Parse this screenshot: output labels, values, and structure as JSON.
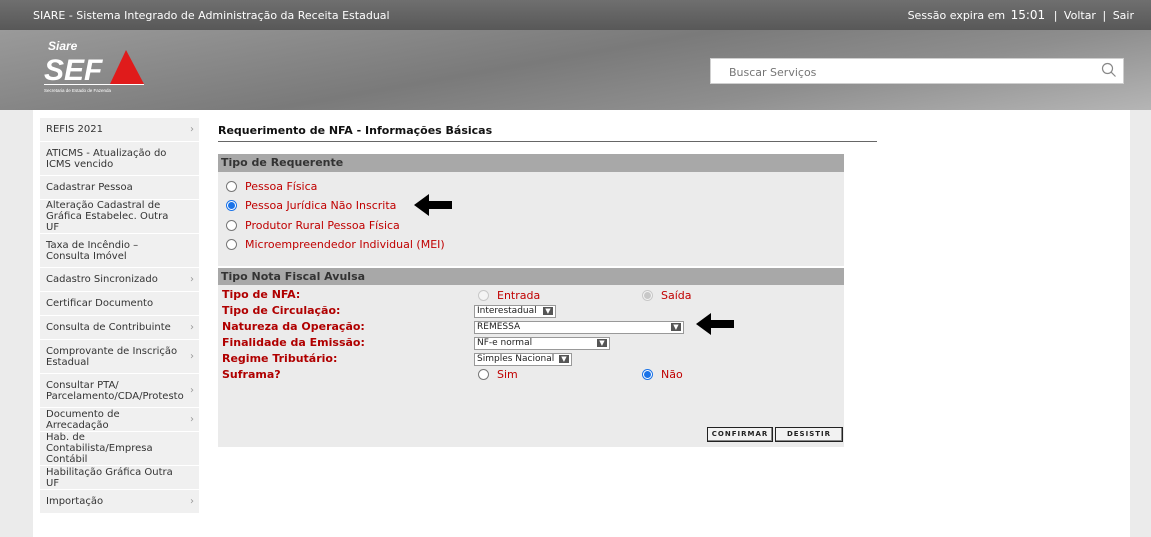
{
  "topbar": {
    "app_title": "SIARE - Sistema Integrado de Administração da Receita Estadual",
    "session_label": "Sessão expira em",
    "session_time": "15:01",
    "sep": "|",
    "back_link": "Voltar",
    "exit_link": "Sair"
  },
  "header": {
    "logo_top": "Siare",
    "logo_main": "SEF",
    "logo_sub": "Secretaria de Estado de Fazenda",
    "search_placeholder": "Buscar Serviços"
  },
  "sidebar": {
    "items": [
      {
        "label": "REFIS 2021",
        "has_submenu": true
      },
      {
        "label": "ATICMS - Atualização do ICMS vencido",
        "has_submenu": false
      },
      {
        "label": "Cadastrar Pessoa",
        "has_submenu": false
      },
      {
        "label": "Alteração Cadastral de Gráfica Estabelec. Outra UF",
        "has_submenu": false
      },
      {
        "label": "Taxa de Incêndio – Consulta Imóvel",
        "has_submenu": false
      },
      {
        "label": "Cadastro Sincronizado",
        "has_submenu": true
      },
      {
        "label": "Certificar Documento",
        "has_submenu": false
      },
      {
        "label": "Consulta de Contribuinte",
        "has_submenu": true
      },
      {
        "label": "Comprovante de Inscrição Estadual",
        "has_submenu": true
      },
      {
        "label": "Consultar PTA/ Parcelamento/CDA/Protesto",
        "has_submenu": true
      },
      {
        "label": "Documento de Arrecadação",
        "has_submenu": true
      },
      {
        "label": "Hab. de Contabilista/Empresa Contábil",
        "has_submenu": false
      },
      {
        "label": "Habilitação Gráfica Outra UF",
        "has_submenu": false
      },
      {
        "label": "Importação",
        "has_submenu": true
      }
    ]
  },
  "main": {
    "page_title": "Requerimento de NFA - Informações Básicas",
    "tipo_requerente": {
      "header": "Tipo de Requerente",
      "options": [
        {
          "label": "Pessoa Física",
          "checked": false
        },
        {
          "label": "Pessoa Jurídica Não Inscrita",
          "checked": true
        },
        {
          "label": "Produtor Rural Pessoa Física",
          "checked": false
        },
        {
          "label": "Microempreendedor Individual (MEI)",
          "checked": false
        }
      ]
    },
    "tipo_nota": {
      "header": "Tipo Nota Fiscal Avulsa",
      "tipo_nfa_label": "Tipo de NFA:",
      "tipo_nfa_entrada": "Entrada",
      "tipo_nfa_saida": "Saída",
      "tipo_nfa_selected": "Saída",
      "circulacao_label": "Tipo de Circulação:",
      "circulacao_value": "Interestadual",
      "natureza_label": "Natureza da Operação:",
      "natureza_value": "REMESSA",
      "finalidade_label": "Finalidade da Emissão:",
      "finalidade_value": "NF-e normal",
      "regime_label": "Regime Tributário:",
      "regime_value": "Simples Nacional",
      "suframa_label": "Suframa?",
      "suframa_sim": "Sim",
      "suframa_nao": "Não",
      "suframa_selected": "Não"
    },
    "buttons": {
      "confirm": "CONFIRMAR",
      "cancel": "DESISTIR"
    }
  },
  "colors": {
    "topbar": "#616161",
    "red_label": "#c00000",
    "radio_accent": "#1a73e8",
    "section_header": "#a8a8a8",
    "panel_bg": "#ebebeb"
  },
  "icons": {
    "search": "search-icon",
    "submenu": "chevron-right-icon",
    "annotation": "arrow-left-icon"
  }
}
